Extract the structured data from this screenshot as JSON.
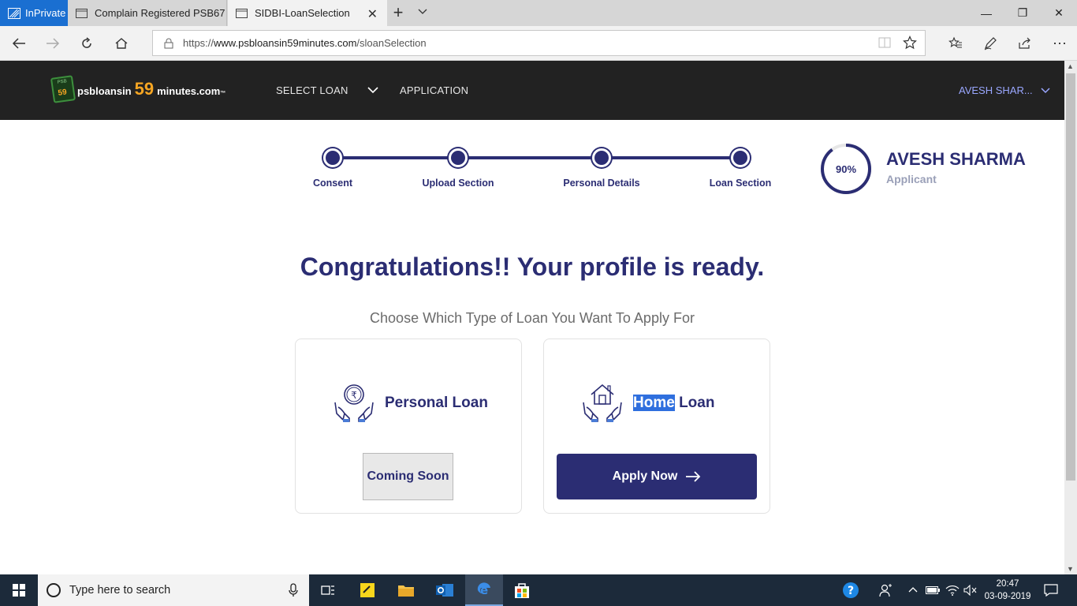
{
  "browser": {
    "inprivate_label": "InPrivate",
    "tabs": [
      {
        "title": "Complain Registered PSB67"
      },
      {
        "title": "SIDBI-LoanSelection"
      }
    ],
    "url_scheme": "https://",
    "url_host": "www.psbloansin59minutes.com",
    "url_path": "/sloanSelection"
  },
  "site": {
    "logo_prefix": "psbloansin",
    "logo_number": "59",
    "logo_suffix": "minutes.com",
    "logo_tm": "™",
    "logo_badge_top": "PSB",
    "logo_badge_num": "59",
    "nav": {
      "select_loan": "SELECT LOAN",
      "application": "APPLICATION",
      "user": "AVESH SHAR..."
    }
  },
  "stepper": {
    "steps": [
      {
        "label": "Consent"
      },
      {
        "label": "Upload Section"
      },
      {
        "label": "Personal Details"
      },
      {
        "label": "Loan Section"
      }
    ]
  },
  "profile": {
    "progress_percent": 90,
    "progress_label": "90%",
    "name": "AVESH SHARMA",
    "role": "Applicant"
  },
  "main": {
    "headline": "Congratulations!! Your profile is ready.",
    "subline": "Choose Which Type of Loan You Want To Apply For",
    "cards": [
      {
        "title": "Personal Loan",
        "action": "Coming Soon",
        "icon": "rupee-hands-icon"
      },
      {
        "title_highlight": "Home",
        "title_rest": "Loan",
        "action": "Apply Now",
        "icon": "house-hands-icon"
      }
    ]
  },
  "taskbar": {
    "search_placeholder": "Type here to search",
    "time": "20:47",
    "date": "03-09-2019"
  },
  "colors": {
    "brand": "#2b2d73",
    "header_bg": "#222222",
    "accent_orange": "#f6a623",
    "inprivate_blue": "#1a6fd1"
  }
}
